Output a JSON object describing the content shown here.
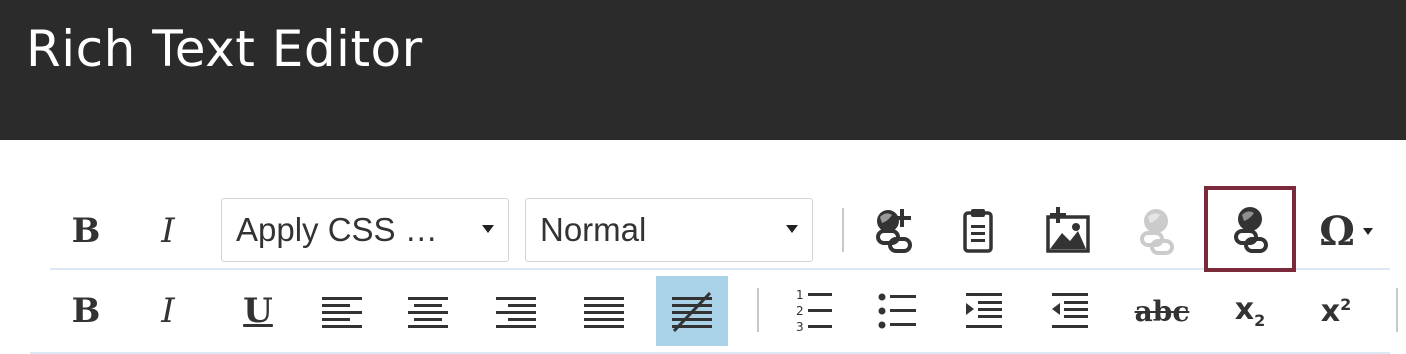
{
  "title": "Rich Text Editor",
  "toolbar": {
    "row1": {
      "bold": {
        "label": "B",
        "icon": "bold-icon"
      },
      "italic": {
        "label": "I",
        "icon": "italic-icon"
      },
      "css_class_select": {
        "value": "Apply CSS …"
      },
      "format_select": {
        "value": "Normal"
      },
      "insert_link": {
        "icon": "insert-link-icon"
      },
      "paste": {
        "icon": "paste-clipboard-icon"
      },
      "insert_image": {
        "icon": "insert-image-icon"
      },
      "unlink_disabled": {
        "icon": "unlink-icon",
        "state": "disabled"
      },
      "unlink_highlighted": {
        "icon": "unlink-icon",
        "state": "highlighted",
        "highlight_color": "#7b2a3c"
      },
      "special_char": {
        "label": "Ω",
        "icon": "omega-icon"
      }
    },
    "row2": {
      "bold": {
        "label": "B",
        "icon": "bold-icon"
      },
      "italic": {
        "label": "I",
        "icon": "italic-icon"
      },
      "underline": {
        "label": "U",
        "icon": "underline-icon"
      },
      "align_left": {
        "icon": "align-left-icon"
      },
      "align_center": {
        "icon": "align-center-icon"
      },
      "align_right": {
        "icon": "align-right-icon"
      },
      "justify": {
        "icon": "justify-icon"
      },
      "remove_format": {
        "icon": "remove-format-icon",
        "state": "active",
        "active_color": "#a9d1e8"
      },
      "ordered_list": {
        "icon": "ordered-list-icon"
      },
      "bullet_list": {
        "icon": "bullet-list-icon"
      },
      "indent": {
        "icon": "indent-icon"
      },
      "outdent": {
        "icon": "outdent-icon"
      },
      "strikethrough": {
        "label": "abc",
        "icon": "strikethrough-icon"
      },
      "subscript": {
        "label": "x",
        "sub": "2",
        "icon": "subscript-icon"
      },
      "superscript": {
        "label": "x",
        "sup": "2",
        "icon": "superscript-icon"
      }
    }
  }
}
